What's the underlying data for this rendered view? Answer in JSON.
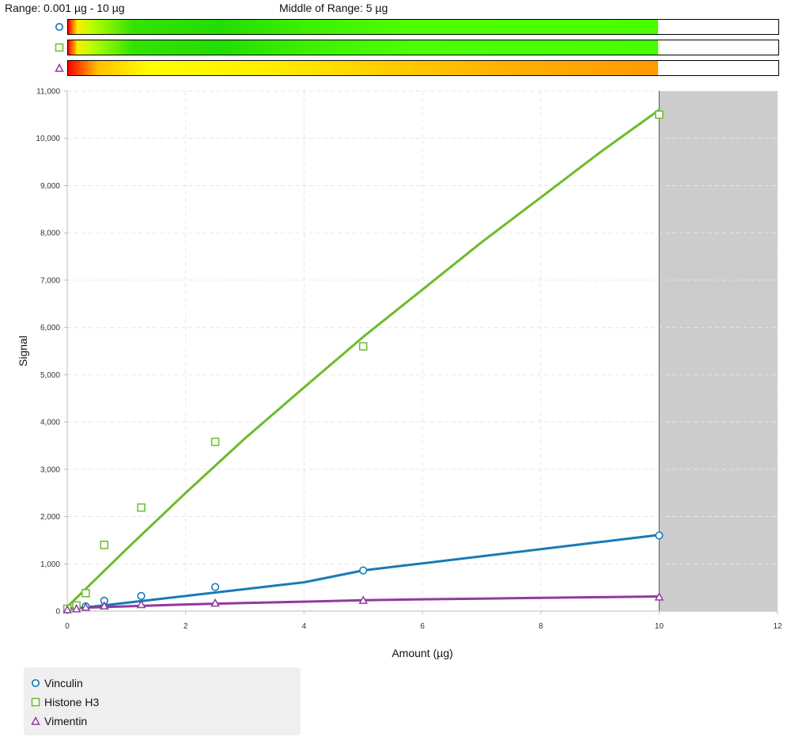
{
  "header": {
    "range_text": "Range: 0.001 µg - 10 µg",
    "middle_text": "Middle of Range: 5 µg"
  },
  "colors": {
    "vinculin": "#1a7ab8",
    "histone": "#6cbb2c",
    "vimentin": "#913a9e",
    "out_of_range": "#cccccc"
  },
  "chart_data": {
    "type": "scatter",
    "xlabel": "Amount (µg)",
    "ylabel": "Signal",
    "xlim": [
      0,
      12
    ],
    "ylim": [
      0,
      11000
    ],
    "xticks": [
      0,
      2,
      4,
      6,
      8,
      10,
      12
    ],
    "yticks": [
      0,
      1000,
      2000,
      3000,
      4000,
      5000,
      6000,
      7000,
      8000,
      9000,
      10000,
      11000
    ],
    "ytick_labels": [
      "0",
      "1,000",
      "2,000",
      "3,000",
      "4,000",
      "5,000",
      "6,000",
      "7,000",
      "8,000",
      "9,000",
      "10,000",
      "11,000"
    ],
    "shaded_region_x": [
      10,
      12
    ],
    "grid": true,
    "legend_position": "bottom-left",
    "series": [
      {
        "name": "Vinculin",
        "marker": "circle",
        "color": "#1a7ab8",
        "x": [
          0.001,
          0.156,
          0.3125,
          0.625,
          1.25,
          2.5,
          5,
          10
        ],
        "y": [
          30,
          60,
          100,
          220,
          320,
          510,
          860,
          1600
        ],
        "fit_x": [
          0.001,
          0.5,
          1,
          2,
          3,
          4,
          5,
          6,
          7,
          8,
          9,
          10
        ],
        "fit_y": [
          40,
          105,
          175,
          320,
          465,
          610,
          860,
          1010,
          1160,
          1310,
          1460,
          1610
        ]
      },
      {
        "name": "Histone H3",
        "marker": "square",
        "color": "#6cbb2c",
        "x": [
          0.001,
          0.156,
          0.3125,
          0.625,
          1.25,
          2.5,
          5,
          10
        ],
        "y": [
          50,
          120,
          380,
          1400,
          2190,
          3580,
          5600,
          10500
        ],
        "fit_x": [
          0.001,
          1,
          2,
          3,
          4,
          5,
          6,
          7,
          8,
          9,
          10
        ],
        "fit_y": [
          90,
          1310,
          2500,
          3650,
          4730,
          5800,
          6800,
          7800,
          8750,
          9700,
          10600
        ]
      },
      {
        "name": "Vimentin",
        "marker": "triangle",
        "color": "#913a9e",
        "x": [
          0.001,
          0.156,
          0.3125,
          0.625,
          1.25,
          2.5,
          5,
          10
        ],
        "y": [
          30,
          50,
          80,
          110,
          140,
          170,
          230,
          300
        ],
        "fit_x": [
          0.001,
          1,
          2,
          3,
          4,
          5,
          6,
          7,
          8,
          9,
          10
        ],
        "fit_y": [
          60,
          100,
          140,
          170,
          200,
          230,
          250,
          265,
          280,
          295,
          310
        ]
      }
    ]
  }
}
